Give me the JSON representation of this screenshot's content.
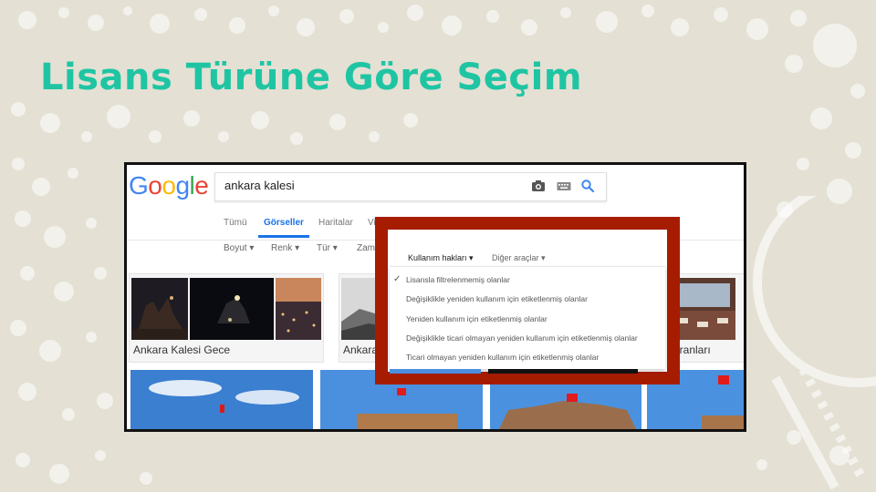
{
  "slide": {
    "title": "Lisans Türüne Göre Seçim"
  },
  "colors": {
    "title": "#1fc5a3",
    "background": "#e4e0d4",
    "highlight_frame": "#a61c00",
    "google_blue": "#4285f4",
    "google_red": "#ea4335",
    "google_yellow": "#fbbc05",
    "google_green": "#34a853"
  },
  "google": {
    "logo_letters": [
      "G",
      "o",
      "o",
      "g",
      "l",
      "e"
    ],
    "search": {
      "value": "ankara kalesi",
      "icons": [
        "camera-icon",
        "keyboard-icon",
        "search-icon"
      ]
    },
    "tabs": [
      "Tümü",
      "Görseller",
      "Haritalar",
      "Vi"
    ],
    "active_tab": "Görseller",
    "tools": [
      "Boyut",
      "Renk",
      "Tür",
      "Zama"
    ],
    "results": [
      {
        "label": "Ankara Kalesi Gece"
      },
      {
        "label": "Ankara"
      },
      {
        "label": "oranları"
      }
    ]
  },
  "usage_rights": {
    "header": "Kullanım hakları",
    "other_tools": "Diğer araçlar",
    "options": [
      "Lisansla filtrelenmemiş olanlar",
      "Değişiklikle yeniden kullanım için etiketlenmiş olanlar",
      "Yeniden kullanım için etiketlenmiş olanlar",
      "Değişiklikle ticari olmayan yeniden kullanım için etiketlenmiş olanlar",
      "Ticari olmayan yeniden kullanım için etiketlenmiş olanlar"
    ],
    "selected_index": 0
  }
}
